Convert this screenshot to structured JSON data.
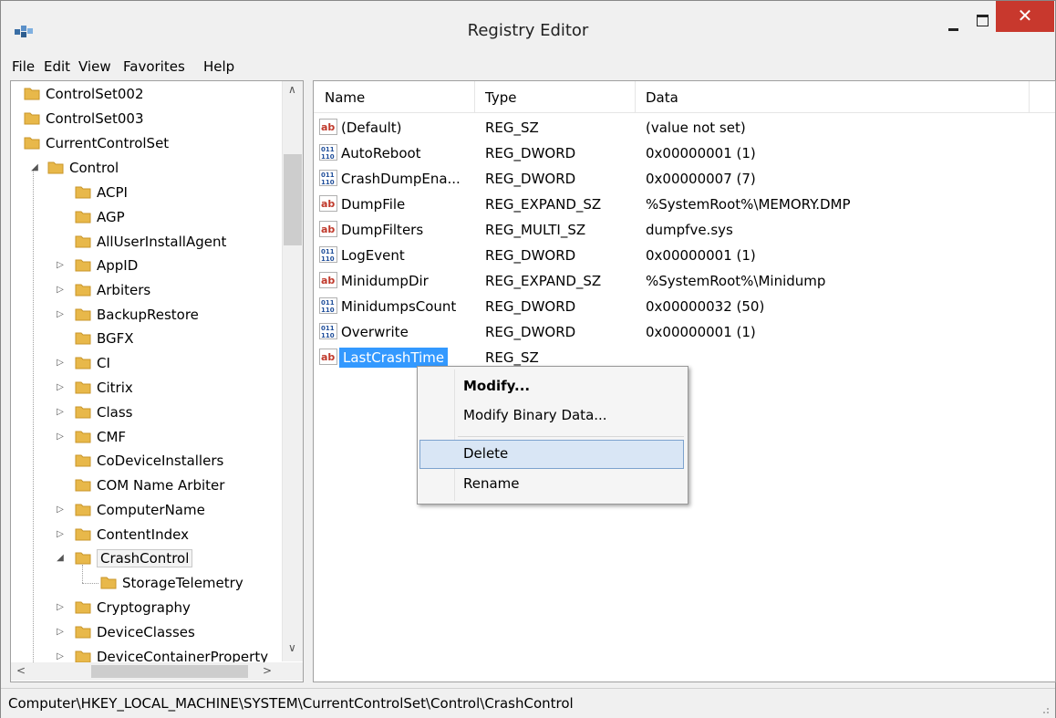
{
  "window": {
    "title": "Registry Editor",
    "close_glyph": "✕"
  },
  "menu": [
    "File",
    "Edit",
    "View",
    "Favorites",
    "Help"
  ],
  "tree": {
    "items": [
      {
        "label": "ControlSet002"
      },
      {
        "label": "ControlSet003"
      },
      {
        "label": "CurrentControlSet"
      },
      {
        "label": "Control"
      },
      {
        "label": "ACPI"
      },
      {
        "label": "AGP"
      },
      {
        "label": "AllUserInstallAgent"
      },
      {
        "label": "AppID"
      },
      {
        "label": "Arbiters"
      },
      {
        "label": "BackupRestore"
      },
      {
        "label": "BGFX"
      },
      {
        "label": "CI"
      },
      {
        "label": "Citrix"
      },
      {
        "label": "Class"
      },
      {
        "label": "CMF"
      },
      {
        "label": "CoDeviceInstallers"
      },
      {
        "label": "COM Name Arbiter"
      },
      {
        "label": "ComputerName"
      },
      {
        "label": "ContentIndex"
      },
      {
        "label": "CrashControl"
      },
      {
        "label": "StorageTelemetry"
      },
      {
        "label": "Cryptography"
      },
      {
        "label": "DeviceClasses"
      },
      {
        "label": "DeviceContainerProperty"
      }
    ]
  },
  "list": {
    "headers": {
      "name": "Name",
      "type": "Type",
      "data": "Data"
    },
    "rows": [
      {
        "icon": "string-value-icon",
        "name": "(Default)",
        "type": "REG_SZ",
        "data": "(value not set)"
      },
      {
        "icon": "binary-value-icon",
        "name": "AutoReboot",
        "type": "REG_DWORD",
        "data": "0x00000001 (1)"
      },
      {
        "icon": "binary-value-icon",
        "name": "CrashDumpEna...",
        "type": "REG_DWORD",
        "data": "0x00000007 (7)"
      },
      {
        "icon": "string-value-icon",
        "name": "DumpFile",
        "type": "REG_EXPAND_SZ",
        "data": "%SystemRoot%\\MEMORY.DMP"
      },
      {
        "icon": "string-value-icon",
        "name": "DumpFilters",
        "type": "REG_MULTI_SZ",
        "data": "dumpfve.sys"
      },
      {
        "icon": "binary-value-icon",
        "name": "LogEvent",
        "type": "REG_DWORD",
        "data": "0x00000001 (1)"
      },
      {
        "icon": "string-value-icon",
        "name": "MinidumpDir",
        "type": "REG_EXPAND_SZ",
        "data": "%SystemRoot%\\Minidump"
      },
      {
        "icon": "binary-value-icon",
        "name": "MinidumpsCount",
        "type": "REG_DWORD",
        "data": "0x00000032 (50)"
      },
      {
        "icon": "binary-value-icon",
        "name": "Overwrite",
        "type": "REG_DWORD",
        "data": "0x00000001 (1)"
      },
      {
        "icon": "string-value-icon",
        "name": "LastCrashTime",
        "type": "REG_SZ",
        "data": ""
      }
    ]
  },
  "context_menu": {
    "items": [
      "Modify...",
      "Modify Binary Data...",
      "Delete",
      "Rename"
    ],
    "highlighted": "Delete"
  },
  "status": {
    "path": "Computer\\HKEY_LOCAL_MACHINE\\SYSTEM\\CurrentControlSet\\Control\\CrashControl"
  },
  "colors": {
    "selection": "#3399ff",
    "close_button": "#c8382d",
    "folder": "#e8b84a",
    "menu_hover": "#d9e6f5"
  }
}
